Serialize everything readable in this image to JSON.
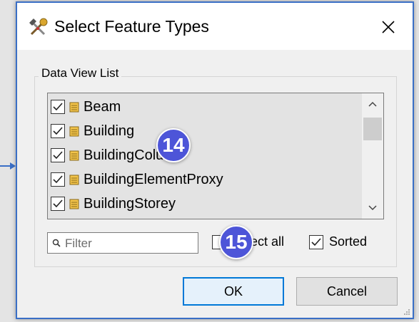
{
  "dialog": {
    "title": "Select Feature Types",
    "close_glyph": "✕",
    "icon": "tools-icon"
  },
  "group": {
    "label": "Data View List"
  },
  "list": {
    "items": [
      {
        "label": "Beam",
        "checked": true
      },
      {
        "label": "Building",
        "checked": true
      },
      {
        "label": "BuildingColumn",
        "checked": true
      },
      {
        "label": "BuildingElementProxy",
        "checked": true
      },
      {
        "label": "BuildingStorey",
        "checked": true
      }
    ]
  },
  "filter": {
    "placeholder": "Filter",
    "value": ""
  },
  "options": {
    "select_all_label": "Select all",
    "select_all_checked": false,
    "sorted_label": "Sorted",
    "sorted_checked": true
  },
  "buttons": {
    "ok": "OK",
    "cancel": "Cancel"
  },
  "annotations": {
    "badge_14": "14",
    "badge_15": "15"
  },
  "colors": {
    "badge": "#4d55d8",
    "dialog_border": "#3a6fc6",
    "ok_focus": "#0078d7"
  }
}
